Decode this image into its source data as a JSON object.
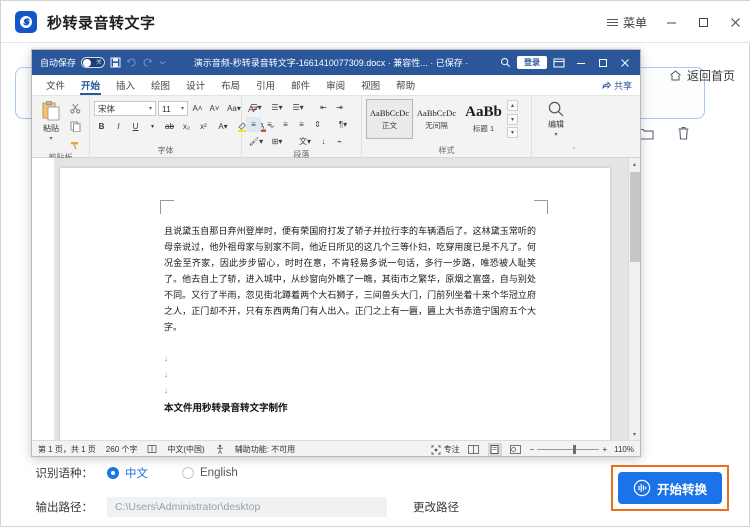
{
  "app": {
    "title": "秒转录音转文字",
    "logo_icon": "app-logo-icon",
    "menu_label": "菜单",
    "menu_icon": "hamburger-icon",
    "minimize_icon": "minimize-icon",
    "maximize_icon": "maximize-icon",
    "close_icon": "close-icon",
    "home_link": "返回首页",
    "home_icon": "home-icon",
    "folder_icon": "folder-icon",
    "trash_icon": "trash-icon"
  },
  "word": {
    "titlebar": {
      "autosave_label": "自动保存",
      "autosave_state": "关",
      "save_icon": "save-icon",
      "undo_icon": "undo-icon",
      "redo_icon": "redo-icon",
      "customize_icon": "chevron-down-icon",
      "document_title": "演示音频-秒转录音转文字-1661410077309.docx  ·  兼容性... · 已保存  ·",
      "search_icon": "search-icon",
      "login_label": "登录",
      "ribbon_display_icon": "ribbon-display-icon",
      "minimize_icon": "minimize-icon",
      "restore_icon": "restore-icon",
      "close_icon": "close-icon"
    },
    "tabs": [
      {
        "label": "文件",
        "active": false
      },
      {
        "label": "开始",
        "active": true
      },
      {
        "label": "插入",
        "active": false
      },
      {
        "label": "绘图",
        "active": false
      },
      {
        "label": "设计",
        "active": false
      },
      {
        "label": "布局",
        "active": false
      },
      {
        "label": "引用",
        "active": false
      },
      {
        "label": "邮件",
        "active": false
      },
      {
        "label": "审阅",
        "active": false
      },
      {
        "label": "视图",
        "active": false
      },
      {
        "label": "帮助",
        "active": false
      }
    ],
    "share_label": "共享",
    "share_icon": "share-icon",
    "ribbon": {
      "clipboard": {
        "name": "剪贴板",
        "paste_label": "粘贴",
        "paste_icon": "paste-icon",
        "cut_icon": "scissors-icon",
        "copy_icon": "copy-icon",
        "format_painter_icon": "format-painter-icon"
      },
      "font": {
        "name": "字体",
        "font_family": "宋体",
        "font_size": "11",
        "grow_icon": "grow-font-icon",
        "shrink_icon": "shrink-font-icon",
        "case_icon": "change-case-icon",
        "clear_icon": "clear-formatting-icon",
        "bold_icon": "bold-icon",
        "italic_icon": "italic-icon",
        "underline_icon": "underline-icon",
        "strike_icon": "strikethrough-icon",
        "subscript_icon": "subscript-icon",
        "superscript_icon": "superscript-icon",
        "text_effects_icon": "text-effects-icon",
        "highlight_icon": "highlight-icon",
        "font_color_icon": "font-color-icon"
      },
      "paragraph": {
        "name": "段落"
      },
      "styles": {
        "name": "样式",
        "items": [
          {
            "sample": "AaBbCcDc",
            "name": "正文",
            "selected": true
          },
          {
            "sample": "AaBbCcDc",
            "name": "无间隔",
            "selected": false
          },
          {
            "sample": "AaBb",
            "name": "标题 1",
            "selected": false
          }
        ]
      },
      "editing": {
        "name": "编辑",
        "icon": "search-icon"
      }
    },
    "document": {
      "paragraph": "且说黛玉自那日弃州登岸时，便有荣国府打发了轿子并拉行李的车辆酒后了。这林黛玉常听的母亲说过，他外祖母家与别家不同，他近日所见的这几个三等仆妇，吃穿用度已是不凡了。何况金至齐家，因此步步留心，时时在意，不肯轻易多说一句话，多行一步路，唯恐被人耻笑了。他去自上了轿，进入城中，从纱窗向外瞧了一瞧，其街市之繁华，原烟之富盛，自与别处不同。又行了半雨，忽见街北蹲着两个大石狮子，三间兽头大门，门前列坐着十来个华冠立府之人，正门却不开，只有东西两角门有人出入。正门之上有一匾，匾上大书赤造宁国府五个大字。",
      "final_line": "本文件用秒转录音转文字制作"
    },
    "status": {
      "page_info": "第 1 页，共 1 页",
      "word_count": "260 个字",
      "proofing_icon": "proofing-icon",
      "language": "中文(中国)",
      "accessibility_icon": "accessibility-icon",
      "accessibility": "辅助功能: 不可用",
      "focus_icon": "focus-icon",
      "focus_label": "专注",
      "view_read_icon": "read-mode-icon",
      "view_print_icon": "print-layout-icon",
      "view_web_icon": "web-layout-icon",
      "zoom_out": "−",
      "zoom_in": "+",
      "zoom_level": "110%"
    }
  },
  "settings": {
    "language_label": "识别语种：",
    "options": [
      {
        "label": "中文",
        "selected": true
      },
      {
        "label": "English",
        "selected": false
      }
    ],
    "output_label": "输出路径：",
    "output_path": "C:\\Users\\Administrator\\desktop",
    "change_path_label": "更改路径",
    "convert_label": "开始转换",
    "convert_icon": "waveform-icon",
    "accent_color": "#1a73e8",
    "highlight_color": "#e8701a"
  }
}
